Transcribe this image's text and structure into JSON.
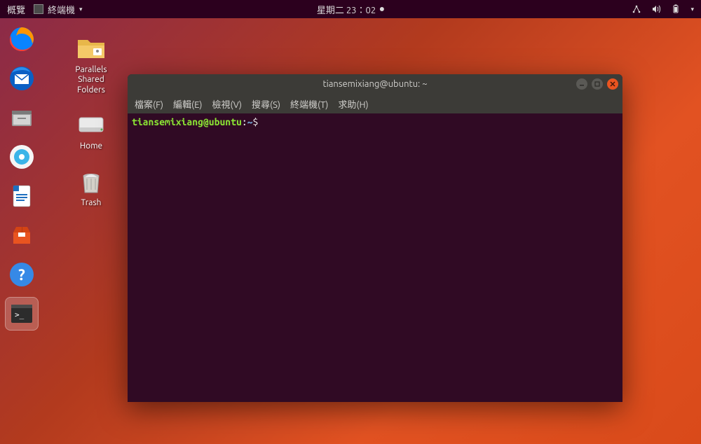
{
  "panel": {
    "activities": "概覽",
    "app_menu": "終端機",
    "clock": "星期二 23：02",
    "tray": {
      "network": "network-icon",
      "volume": "volume-icon",
      "battery": "battery-icon"
    }
  },
  "launcher": {
    "items": [
      {
        "name": "firefox",
        "title": "Firefox"
      },
      {
        "name": "thunderbird",
        "title": "Thunderbird"
      },
      {
        "name": "files",
        "title": "Files"
      },
      {
        "name": "rhythmbox",
        "title": "Rhythmbox"
      },
      {
        "name": "writer",
        "title": "LibreOffice Writer"
      },
      {
        "name": "software",
        "title": "Ubuntu Software"
      },
      {
        "name": "help",
        "title": "Help"
      },
      {
        "name": "terminal",
        "title": "Terminal",
        "active": true
      }
    ]
  },
  "desktop": {
    "icons": [
      {
        "name": "parallels-shared-folders",
        "label": "Parallels\nShared\nFolders"
      },
      {
        "name": "home",
        "label": "Home"
      },
      {
        "name": "trash",
        "label": "Trash"
      }
    ]
  },
  "terminal": {
    "title": "tiansemixiang@ubuntu: ~",
    "menus": [
      "檔案(F)",
      "編輯(E)",
      "檢視(V)",
      "搜尋(S)",
      "終端機(T)",
      "求助(H)"
    ],
    "prompt": {
      "userhost": "tiansemixiang@ubuntu",
      "colon": ":",
      "path": "~",
      "symbol": "$"
    }
  }
}
